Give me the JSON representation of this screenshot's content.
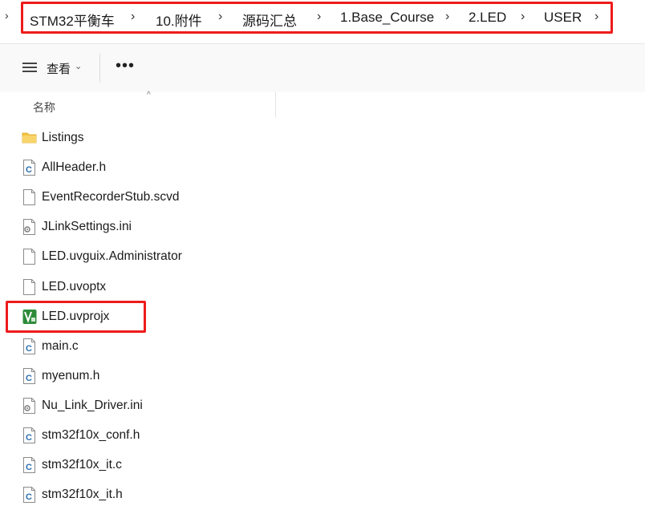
{
  "address_bar": {
    "crumbs": [
      "STM32平衡车",
      "10.附件",
      "源码汇总",
      "1.Base_Course",
      "2.LED",
      "USER"
    ]
  },
  "toolbar": {
    "view_label": "查看",
    "more_label": "•••"
  },
  "columns": {
    "name_header": "名称"
  },
  "files": [
    {
      "name": "Listings",
      "icon": "folder-icon"
    },
    {
      "name": "AllHeader.h",
      "icon": "c-source-file-icon"
    },
    {
      "name": "EventRecorderStub.scvd",
      "icon": "blank-file-icon"
    },
    {
      "name": "JLinkSettings.ini",
      "icon": "settings-file-icon"
    },
    {
      "name": "LED.uvguix.Administrator",
      "icon": "blank-file-icon"
    },
    {
      "name": "LED.uvoptx",
      "icon": "blank-file-icon"
    },
    {
      "name": "LED.uvprojx",
      "icon": "keil-project-icon"
    },
    {
      "name": "main.c",
      "icon": "c-source-file-icon"
    },
    {
      "name": "myenum.h",
      "icon": "c-source-file-icon"
    },
    {
      "name": "Nu_Link_Driver.ini",
      "icon": "settings-file-icon"
    },
    {
      "name": "stm32f10x_conf.h",
      "icon": "c-source-file-icon"
    },
    {
      "name": "stm32f10x_it.c",
      "icon": "c-source-file-icon"
    },
    {
      "name": "stm32f10x_it.h",
      "icon": "c-source-file-icon"
    }
  ],
  "colors": {
    "highlight": "#ee1b1b",
    "folder": "#f4c242",
    "keil_green": "#2e8b3a",
    "c_file_blue": "#2a6fb0"
  }
}
